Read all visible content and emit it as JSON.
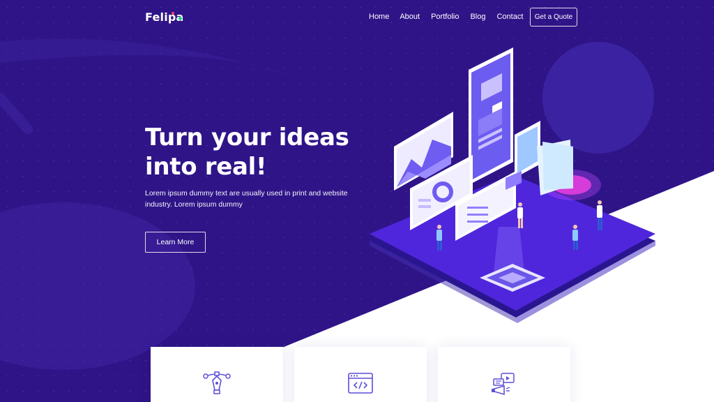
{
  "brand": {
    "name": "Felipa",
    "bg_color": "#2f1488",
    "accent_pink": "#ff3b6b",
    "accent_green": "#19d37a"
  },
  "nav": {
    "items": [
      {
        "label": "Home"
      },
      {
        "label": "About"
      },
      {
        "label": "Portfolio"
      },
      {
        "label": "Blog"
      },
      {
        "label": "Contact"
      }
    ],
    "cta_label": "Get a Quote"
  },
  "hero": {
    "headline_line1": "Turn your ideas",
    "headline_line2": "into real!",
    "subtext": "Lorem ipsum dummy text are usually used in print and website industry. Lorem ipsum dummy",
    "button_label": "Learn More"
  },
  "features": [
    {
      "icon": "pen-tool-icon"
    },
    {
      "icon": "code-window-icon"
    },
    {
      "icon": "megaphone-video-icon"
    }
  ]
}
